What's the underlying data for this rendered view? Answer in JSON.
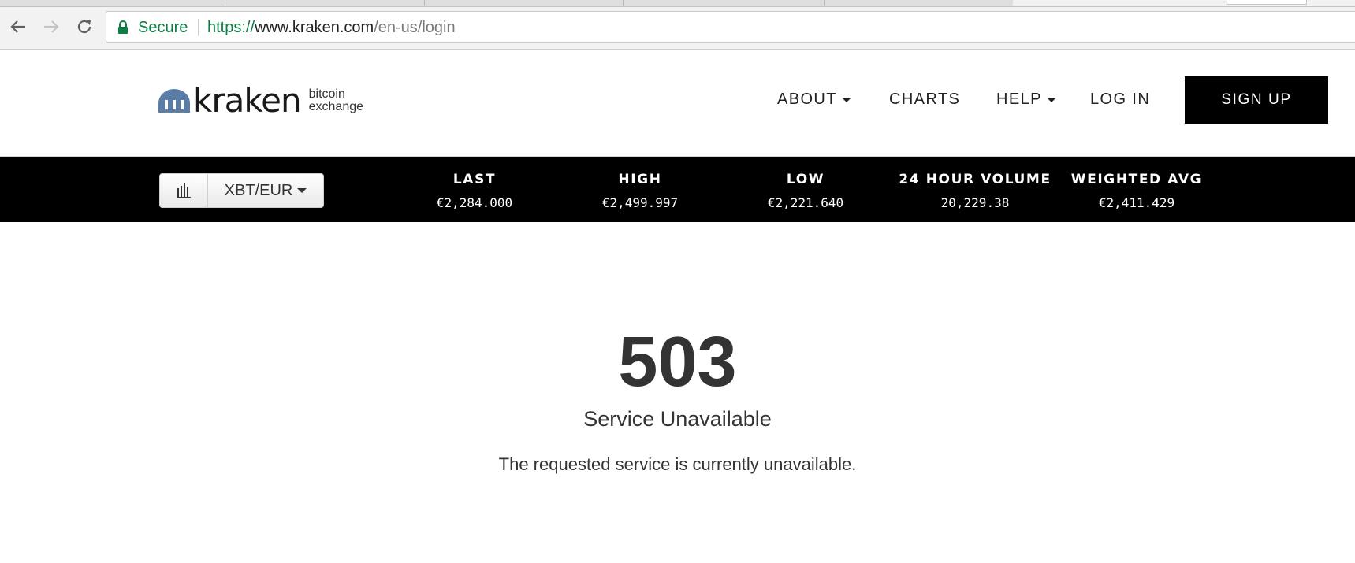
{
  "browser": {
    "secure_label": "Secure",
    "url_scheme": "https://",
    "url_host": "www.kraken.com",
    "url_path": "/en-us/login"
  },
  "header": {
    "logo_word": "kraken",
    "logo_tag_line1": "bitcoin",
    "logo_tag_line2": "exchange",
    "nav": {
      "about": "ABOUT",
      "charts": "CHARTS",
      "help": "HELP",
      "login": "LOG IN",
      "signup": "SIGN UP"
    }
  },
  "ticker": {
    "pair": "XBT/EUR",
    "stats": {
      "last": {
        "label": "LAST",
        "value": "€2,284.000"
      },
      "high": {
        "label": "HIGH",
        "value": "€2,499.997"
      },
      "low": {
        "label": "LOW",
        "value": "€2,221.640"
      },
      "volume": {
        "label": "24 HOUR VOLUME",
        "value": "20,229.38"
      },
      "wavg": {
        "label": "WEIGHTED AVG",
        "value": "€2,411.429"
      }
    }
  },
  "error": {
    "code": "503",
    "title": "Service Unavailable",
    "message": "The requested service is currently unavailable."
  },
  "colors": {
    "secure_green": "#0b8043",
    "logo_blue": "#5a7da8",
    "ticker_bg": "#000000",
    "signup_bg": "#000000"
  }
}
